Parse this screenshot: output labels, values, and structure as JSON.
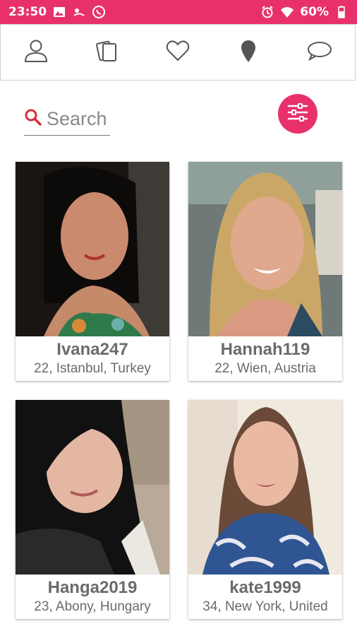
{
  "status_bar": {
    "time": "23:50",
    "battery": "60%",
    "left_icons": [
      "image-icon",
      "weather-icon",
      "whatsapp-icon"
    ],
    "right_icons": [
      "alarm-icon",
      "wifi-icon",
      "battery-icon"
    ],
    "background": "#e8316b"
  },
  "nav": {
    "items": [
      "profile-icon",
      "cards-icon",
      "heart-icon",
      "location-icon",
      "chat-icon"
    ]
  },
  "search": {
    "placeholder": "Search",
    "icon_color": "#d62d3c"
  },
  "filter": {
    "icon": "filter-sliders-icon",
    "color": "#e8316b"
  },
  "profiles": [
    {
      "name": "Ivana247",
      "details": "22, Istanbul, Turkey"
    },
    {
      "name": "Hannah119",
      "details": "22, Wien, Austria"
    },
    {
      "name": "Hanga2019",
      "details": "23, Abony, Hungary"
    },
    {
      "name": "kate1999",
      "details": "34, New York, United"
    }
  ]
}
